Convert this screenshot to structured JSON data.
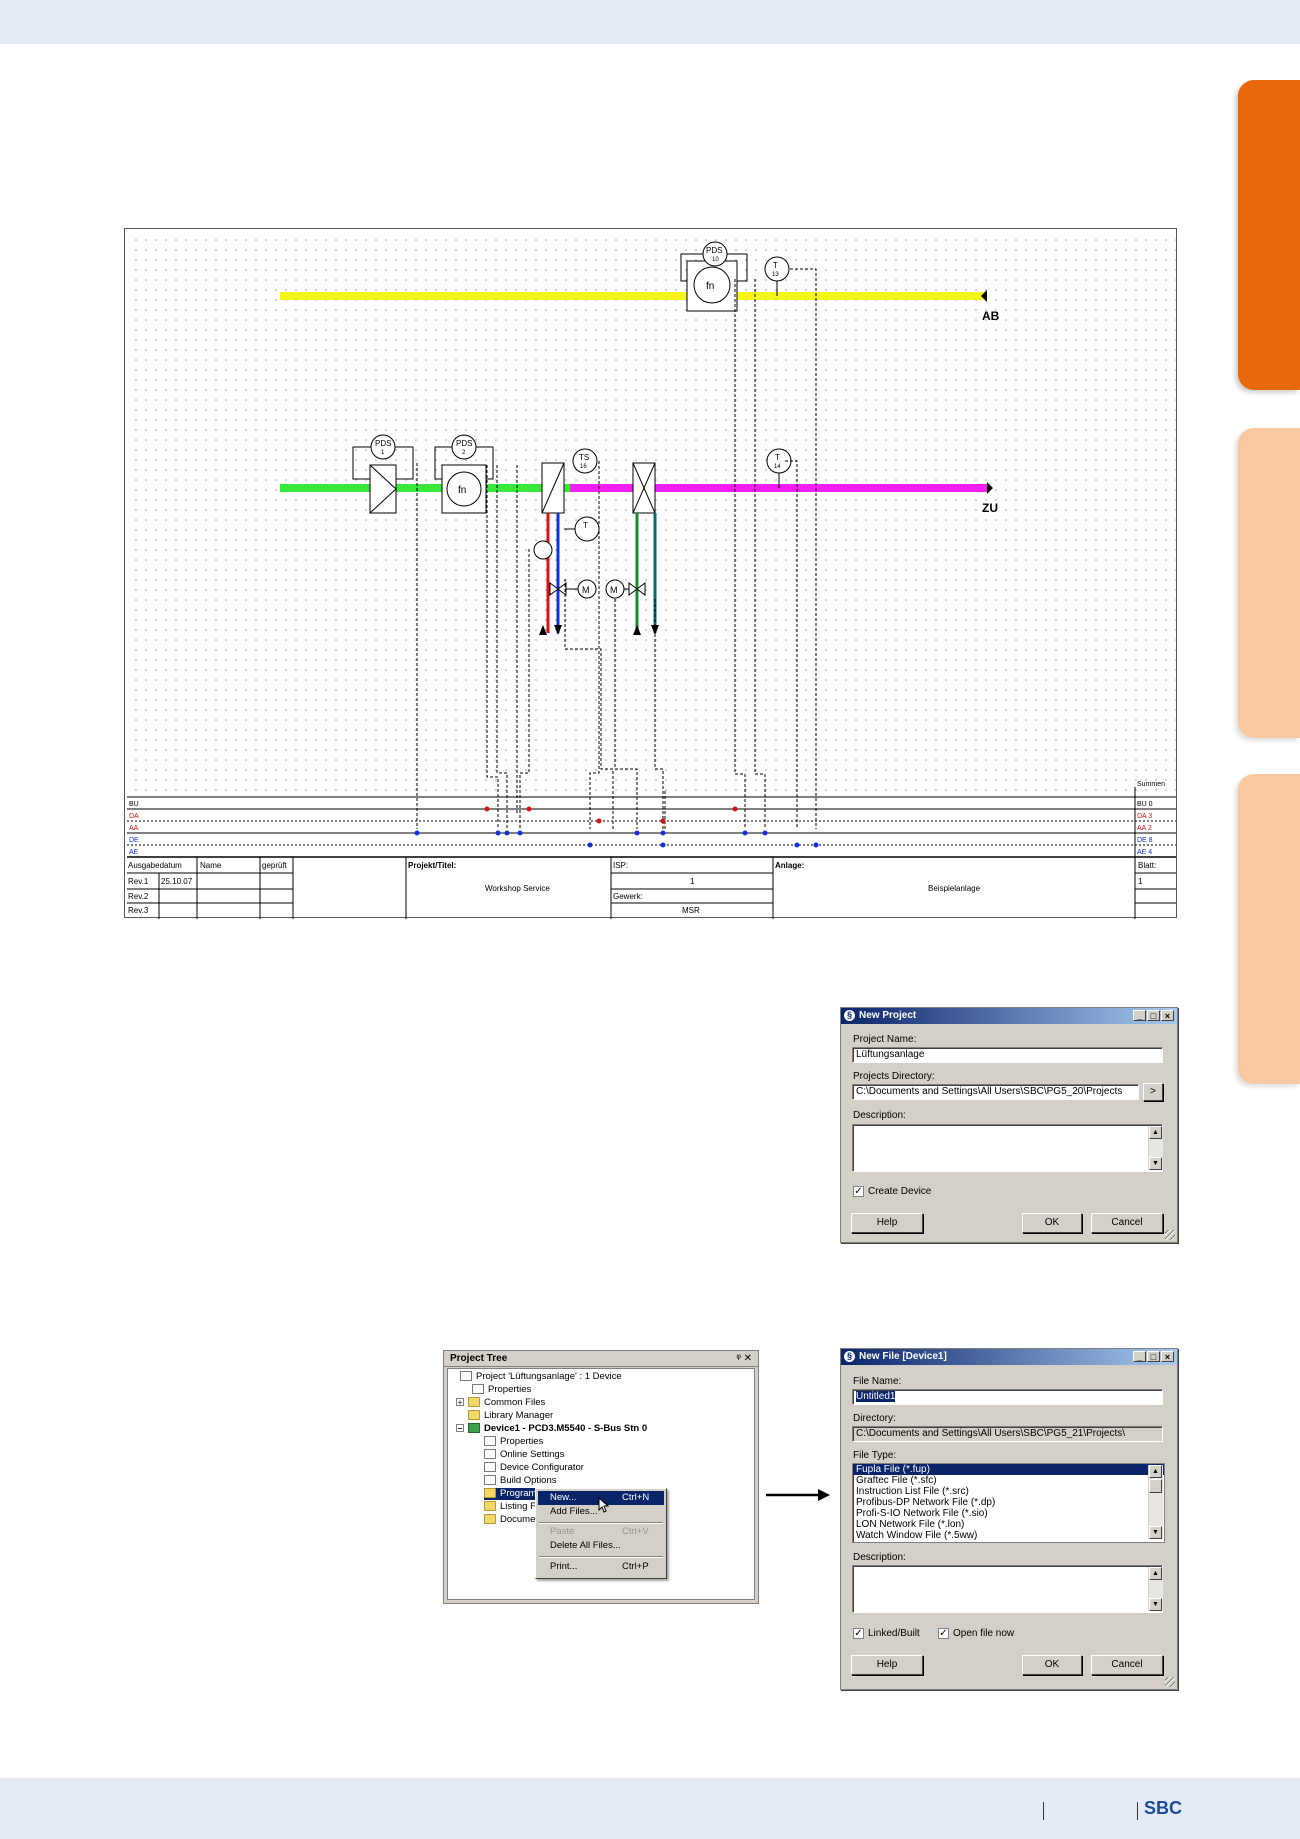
{
  "footer": {
    "brand": "SBC"
  },
  "schematic": {
    "duct_labels": {
      "exhaust": "AB",
      "supply": "ZU"
    },
    "instruments": {
      "pds1": {
        "tag": "PDS",
        "num": "1"
      },
      "pds2": {
        "tag": "PDS",
        "num": "2"
      },
      "pds10": {
        "tag": "PDS",
        "num": "10"
      },
      "ts16": {
        "tag": "TS",
        "num": "16"
      },
      "t13": {
        "tag": "T",
        "num": "13"
      },
      "t14": {
        "tag": "T",
        "num": "14"
      },
      "t": {
        "tag": "T",
        "num": ""
      }
    },
    "fan_label": "fn",
    "motor_label": "M",
    "bus_rows": [
      "BU",
      "DA",
      "AA",
      "DE",
      "AE"
    ],
    "bus_counts_header": "Summen",
    "bus_counts": [
      "BU 0",
      "DA 3",
      "AA 2",
      "DE 8",
      "AE 4"
    ],
    "title_block": {
      "headers": [
        "Ausgabedatum",
        "Name",
        "geprüft"
      ],
      "revisions": [
        {
          "rev": "Rev.1",
          "date": "25.10.07"
        },
        {
          "rev": "Rev.2",
          "date": ""
        },
        {
          "rev": "Rev.3",
          "date": ""
        }
      ],
      "project_label": "Projekt/Titel:",
      "project_value": "Workshop Service",
      "isp_label": "ISP:",
      "isp_value": "1",
      "gewerk_label": "Gewerk:",
      "gewerk_value": "MSR",
      "anlage_label": "Anlage:",
      "anlage_value": "Beispielanlage",
      "blatt_label": "Blatt:",
      "blatt_value": "1"
    }
  },
  "new_project": {
    "title": "New Project",
    "name_label": "Project Name:",
    "name_value": "Lüftungsanlage",
    "dir_label": "Projects Directory:",
    "dir_value": "C:\\Documents and Settings\\All Users\\SBC\\PG5_20\\Projects",
    "browse": ">",
    "desc_label": "Description:",
    "create_device": "Create Device",
    "help": "Help",
    "ok": "OK",
    "cancel": "Cancel"
  },
  "project_tree": {
    "title": "Project Tree",
    "pin": "ᵠ ✕",
    "items": [
      "Project 'Lüftungsanlage' : 1 Device",
      "Properties",
      "Common Files",
      "Library Manager",
      "Device1 - PCD3.M5540 - S-Bus Stn 0",
      "Properties",
      "Online Settings",
      "Device Configurator",
      "Build Options",
      "Program",
      "Listing File",
      "Document"
    ],
    "context_menu": [
      {
        "label": "New...",
        "shortcut": "Ctrl+N"
      },
      {
        "label": "Add Files...",
        "shortcut": ""
      },
      {
        "label": "Paste",
        "shortcut": "Ctrl+V"
      },
      {
        "label": "Delete All Files...",
        "shortcut": ""
      },
      {
        "label": "Print...",
        "shortcut": "Ctrl+P"
      }
    ]
  },
  "new_file": {
    "title": "New File [Device1]",
    "name_label": "File Name:",
    "name_value": "Untitled1",
    "dir_label": "Directory:",
    "dir_value": "C:\\Documents and Settings\\All Users\\SBC\\PG5_21\\Projects\\",
    "type_label": "File Type:",
    "types": [
      "Fupla File (*.fup)",
      "Graftec File (*.sfc)",
      "Instruction List File (*.src)",
      "Profibus-DP Network File (*.dp)",
      "Profi-S-IO Network File (*.sio)",
      "LON Network File (*.lon)",
      "Watch Window File (*.5ww)"
    ],
    "desc_label": "Description:",
    "linked": "Linked/Built",
    "open_now": "Open file now",
    "help": "Help",
    "ok": "OK",
    "cancel": "Cancel"
  },
  "colors": {
    "accent_orange": "#e8680b",
    "tab_light": "#f9c7a0",
    "band": "#e4eaf6",
    "exhaust_duct": "#f5f51a",
    "supply_in": "#39e83a",
    "supply_out": "#f01ef0"
  }
}
